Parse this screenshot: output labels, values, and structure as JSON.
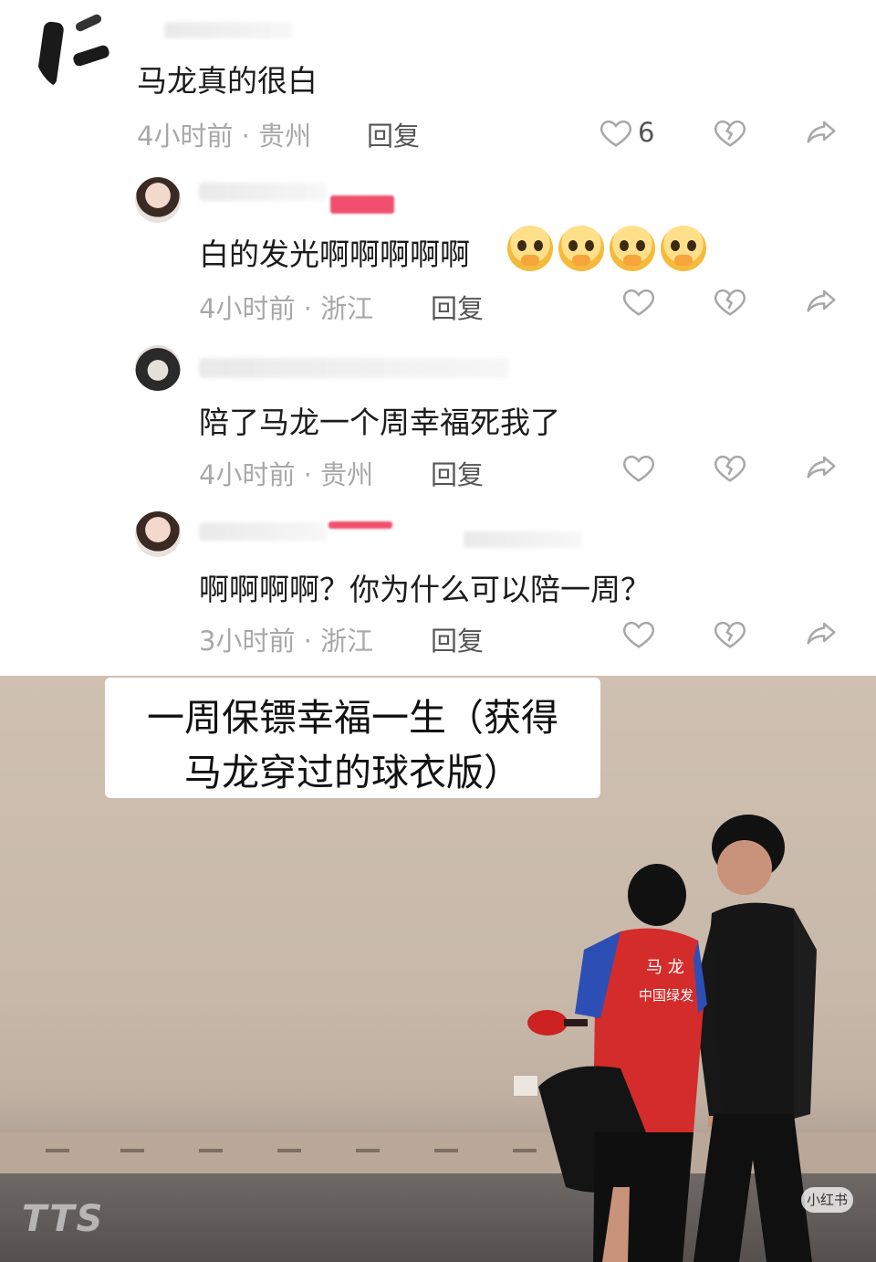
{
  "comments": [
    {
      "text": "马龙真的很白",
      "meta": "4小时前 · 贵州",
      "reply_label": "回复",
      "like_count": "6"
    },
    {
      "text": "白的发光啊啊啊啊啊",
      "emoji_count": 4,
      "meta": "4小时前 · 浙江",
      "reply_label": "回复"
    },
    {
      "text": "陪了马龙一个周幸福死我了",
      "meta": "4小时前 · 贵州",
      "reply_label": "回复"
    },
    {
      "text": "啊啊啊啊？你为什么可以陪一周？",
      "meta": "3小时前 · 浙江",
      "reply_label": "回复"
    }
  ],
  "photo": {
    "caption_line1": "一周保镖幸福一生（获得",
    "caption_line2": "马龙穿过的球衣版）",
    "jersey_name": "马 龙",
    "jersey_sponsor": "中国绿发",
    "watermark_left": "TTS",
    "watermark_right": "小红书"
  },
  "icons": {
    "like": "heart-outline-icon",
    "dislike": "broken-heart-icon",
    "share": "share-arrow-icon"
  },
  "colors": {
    "meta_text": "#a8a8a8",
    "body_text": "#1c1c1c",
    "accent_tag": "#f0506e"
  }
}
